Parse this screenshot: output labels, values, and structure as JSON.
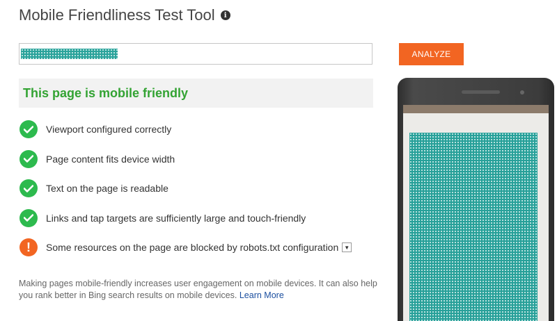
{
  "header": {
    "title": "Mobile Friendliness Test Tool",
    "info_icon": "info-icon"
  },
  "url_input": {
    "value": ""
  },
  "analyze_button": {
    "label": "ANALYZE"
  },
  "result": {
    "headline": "This page is mobile friendly"
  },
  "checks": [
    {
      "status": "pass",
      "icon": "check-icon",
      "text": "Viewport configured correctly"
    },
    {
      "status": "pass",
      "icon": "check-icon",
      "text": "Page content fits device width"
    },
    {
      "status": "pass",
      "icon": "check-icon",
      "text": "Text on the page is readable"
    },
    {
      "status": "pass",
      "icon": "check-icon",
      "text": "Links and tap targets are sufficiently large and touch-friendly"
    },
    {
      "status": "warning",
      "icon": "exclamation-icon",
      "text": "Some resources on the page are blocked by robots.txt configuration",
      "expand_icon": "chevron-down-icon"
    }
  ],
  "footer": {
    "note": "Making pages mobile-friendly increases user engagement on mobile devices. It can also help you rank better in Bing search results on mobile devices.",
    "link_label": "Learn More"
  },
  "colors": {
    "accent": "#f26522",
    "success_text": "#33a333",
    "check_green": "#2dba4e",
    "link": "#1a4e9f"
  }
}
